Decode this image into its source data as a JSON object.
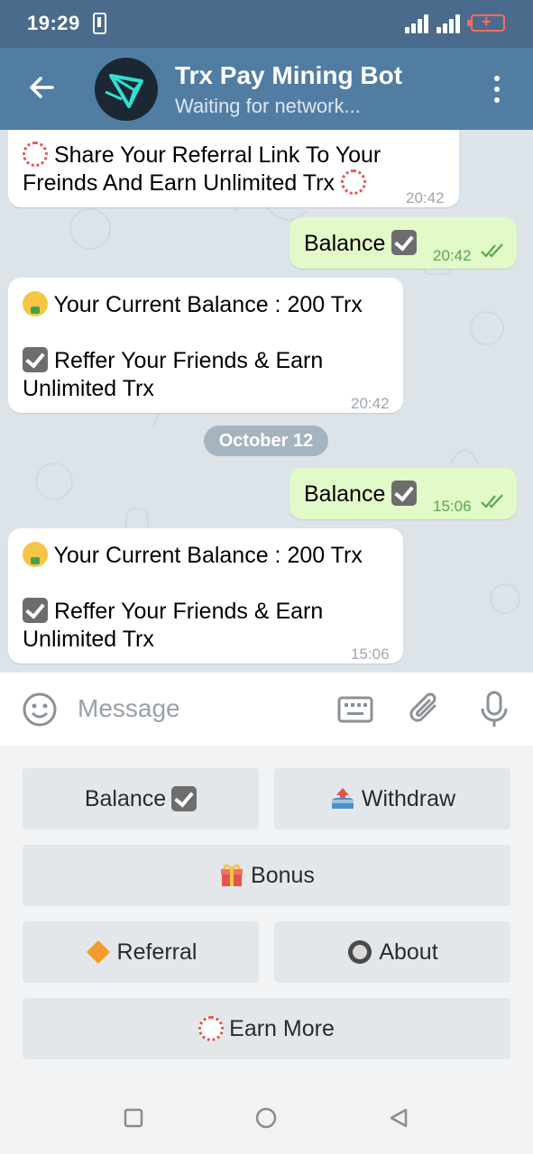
{
  "status": {
    "time": "19:29"
  },
  "header": {
    "title": "Trx Pay Mining Bot",
    "subtitle": "Waiting for network..."
  },
  "messages": [
    {
      "dir": "in",
      "lines": [
        "Share Your Referral Link To Your",
        "Freinds And Earn Unlimited Trx"
      ],
      "time": "20:42"
    },
    {
      "dir": "out",
      "text": "Balance",
      "time": "20:42"
    },
    {
      "dir": "in",
      "line1": "Your Current Balance : 200 Trx",
      "line2": "Reffer Your Friends & Earn",
      "line3": "Unlimited Trx",
      "time": "20:42"
    },
    {
      "dir": "out",
      "text": "Balance",
      "time": "15:06"
    },
    {
      "dir": "in",
      "line1": "Your Current Balance : 200 Trx",
      "line2": "Reffer Your Friends & Earn",
      "line3": "Unlimited Trx",
      "time": "15:06"
    }
  ],
  "date_separator": "October 12",
  "input": {
    "placeholder": "Message"
  },
  "keyboard": {
    "balance": "Balance",
    "withdraw": "Withdraw",
    "bonus": "Bonus",
    "referral": "Referral",
    "about": "About",
    "earn_more": "Earn More"
  },
  "colors": {
    "header": "#527da3",
    "statusbar": "#4a6b8b",
    "bubble_out": "#e2f9c8",
    "read_check": "#5aa84f"
  }
}
